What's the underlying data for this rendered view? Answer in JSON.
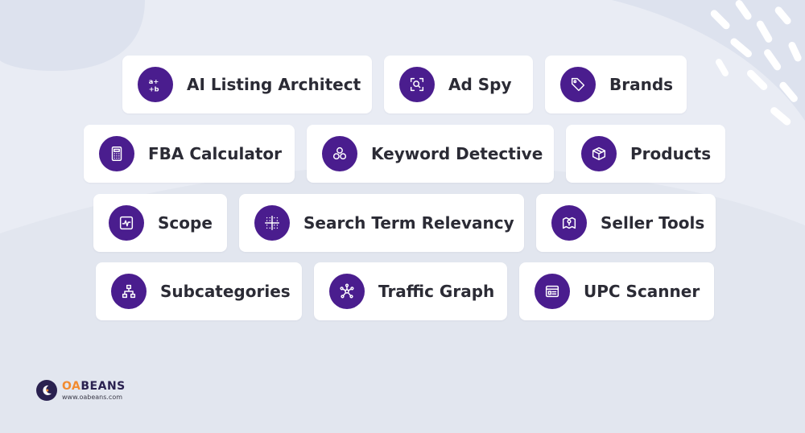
{
  "colors": {
    "icon_bg": "#4a1d8e",
    "card_bg": "#ffffff",
    "page_bg": "#e9ecf4",
    "accent": "#f28b30"
  },
  "tools": [
    {
      "label": "AI Listing Architect",
      "icon": "ai-icon"
    },
    {
      "label": "Ad Spy",
      "icon": "magnify-scan-icon"
    },
    {
      "label": "Brands",
      "icon": "tag-icon"
    },
    {
      "label": "FBA Calculator",
      "icon": "calculator-icon"
    },
    {
      "label": "Keyword Detective",
      "icon": "circles-icon"
    },
    {
      "label": "Products",
      "icon": "box-icon"
    },
    {
      "label": "Scope",
      "icon": "pulse-icon"
    },
    {
      "label": "Search Term Relevancy",
      "icon": "grid-icon"
    },
    {
      "label": "Seller Tools",
      "icon": "map-pin-icon"
    },
    {
      "label": "Subcategories",
      "icon": "hierarchy-icon"
    },
    {
      "label": "Traffic Graph",
      "icon": "network-icon"
    },
    {
      "label": "UPC Scanner",
      "icon": "browser-window-icon"
    }
  ],
  "logo": {
    "brand_prefix": "OA",
    "brand_suffix": "BEANS",
    "url": "www.oabeans.com"
  }
}
